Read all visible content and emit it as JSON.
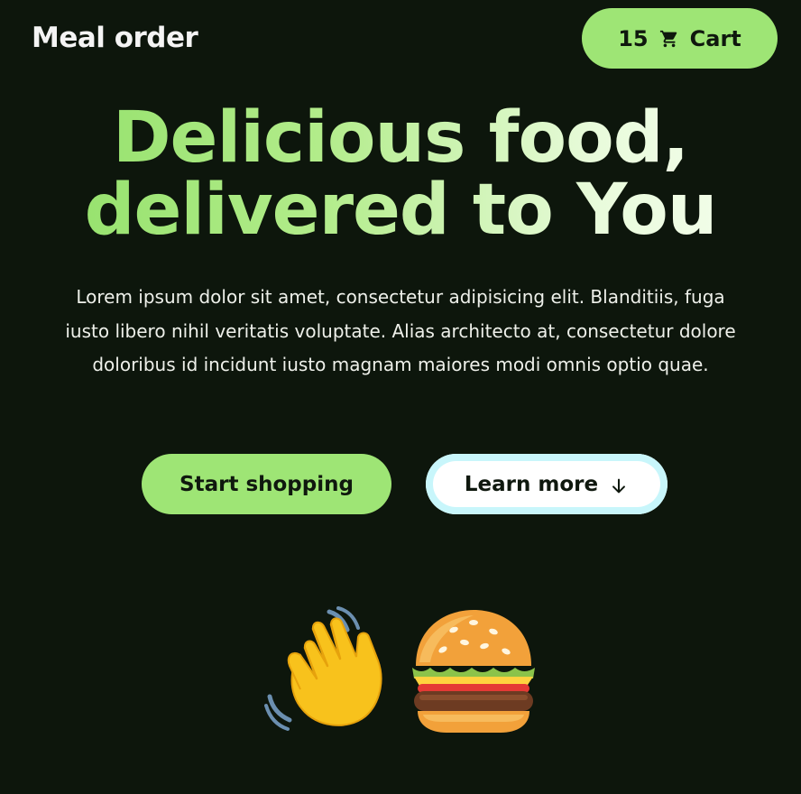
{
  "header": {
    "logo": "Meal order",
    "cart": {
      "count": "15",
      "label": "Cart",
      "icon": "shopping-cart-icon"
    }
  },
  "hero": {
    "title_line1": "Delicious food,",
    "title_line2": "delivered to You",
    "description": "Lorem ipsum dolor sit amet, consectetur adipisicing elit. Blanditiis, fuga iusto libero nihil veritatis voluptate. Alias architecto at, consectetur dolore doloribus id incidunt iusto magnam maiores modi omnis optio quae."
  },
  "actions": {
    "primary_label": "Start shopping",
    "secondary_label": "Learn more",
    "secondary_icon": "arrow-down-icon"
  },
  "emojis": [
    {
      "name": "waving-hand",
      "icon": "waving-hand-icon"
    },
    {
      "name": "hamburger",
      "icon": "hamburger-icon"
    }
  ],
  "colors": {
    "background": "#0d160c",
    "accent": "#9ee575",
    "secondary_border": "#c8f6fb"
  }
}
